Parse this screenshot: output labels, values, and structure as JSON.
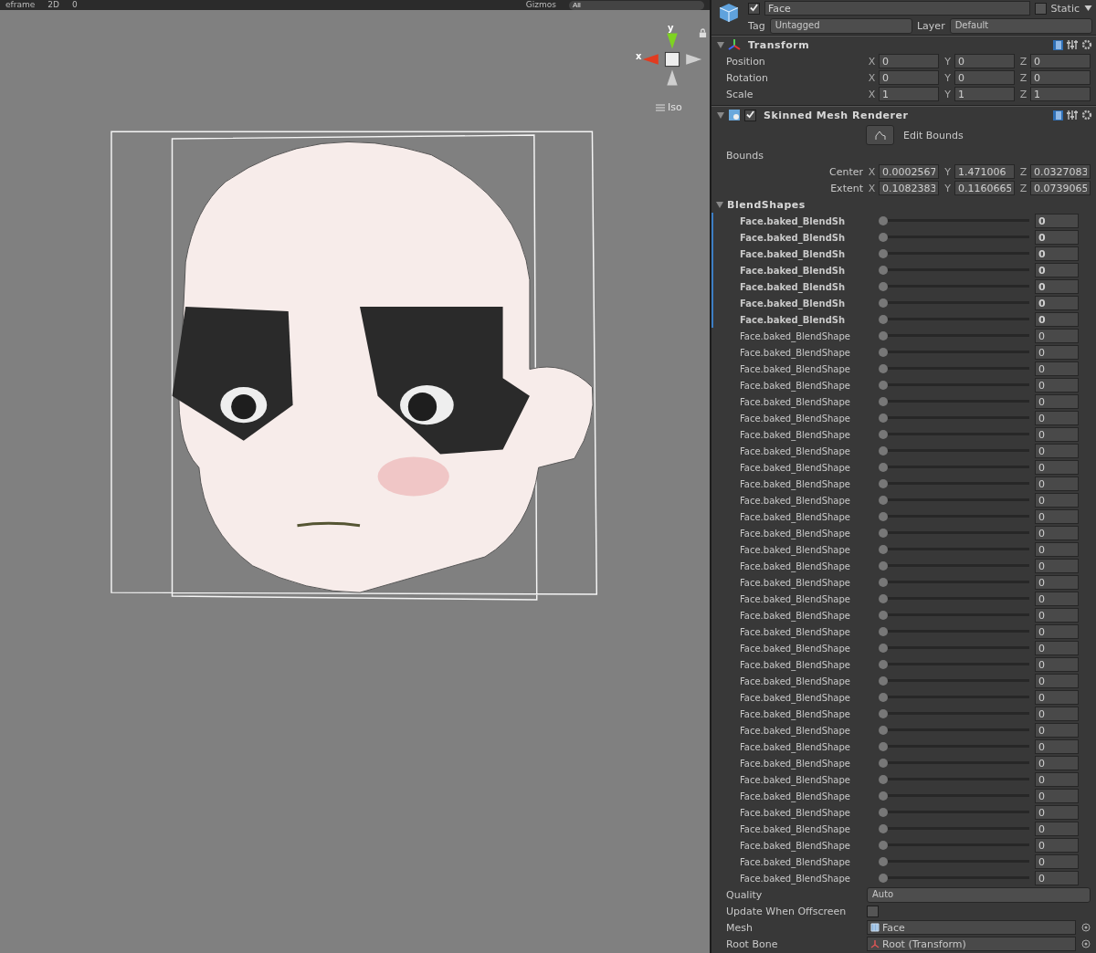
{
  "scene_toolbar": {
    "items": [
      "eframe",
      "2D",
      "0",
      "Gizmos"
    ],
    "search": {
      "placeholder": "All"
    }
  },
  "scene_view": {
    "gizmo": {
      "x_label": "x",
      "y_label": "y"
    },
    "projection": "Iso"
  },
  "inspector": {
    "object": {
      "active": true,
      "name": "Face",
      "static": false,
      "static_label": "Static",
      "tag_label": "Tag",
      "tag": "Untagged",
      "layer_label": "Layer",
      "layer": "Default"
    },
    "transform": {
      "title": "Transform",
      "expanded": true,
      "rows": [
        {
          "label": "Position",
          "fields": [
            {
              "axis": "X",
              "value": "0"
            },
            {
              "axis": "Y",
              "value": "0"
            },
            {
              "axis": "Z",
              "value": "0"
            }
          ]
        },
        {
          "label": "Rotation",
          "fields": [
            {
              "axis": "X",
              "value": "0"
            },
            {
              "axis": "Y",
              "value": "0"
            },
            {
              "axis": "Z",
              "value": "0"
            }
          ]
        },
        {
          "label": "Scale",
          "fields": [
            {
              "axis": "X",
              "value": "1"
            },
            {
              "axis": "Y",
              "value": "1"
            },
            {
              "axis": "Z",
              "value": "1"
            }
          ]
        }
      ]
    },
    "skinned_mesh_renderer": {
      "title": "Skinned Mesh Renderer",
      "enabled": true,
      "expanded": true,
      "edit_bounds": "Edit Bounds",
      "bounds_label": "Bounds",
      "bounds": [
        {
          "label": "Center",
          "fields": [
            {
              "axis": "X",
              "value": "0.0002567"
            },
            {
              "axis": "Y",
              "value": "1.471006"
            },
            {
              "axis": "Z",
              "value": "0.0327083"
            }
          ]
        },
        {
          "label": "Extent",
          "fields": [
            {
              "axis": "X",
              "value": "0.1082383"
            },
            {
              "axis": "Y",
              "value": "0.1160665"
            },
            {
              "axis": "Z",
              "value": "0.0739065"
            }
          ]
        }
      ],
      "blendshapes_title": "BlendShapes",
      "blendshapes_expanded": true,
      "blendshapes": [
        {
          "name": "Face.baked_BlendSh",
          "modified": true,
          "level": 0,
          "value": "0"
        },
        {
          "name": "Face.baked_BlendSh",
          "modified": true,
          "level": 0,
          "value": "0"
        },
        {
          "name": "Face.baked_BlendSh",
          "modified": true,
          "level": 0,
          "value": "0"
        },
        {
          "name": "Face.baked_BlendSh",
          "modified": true,
          "level": 0,
          "value": "0"
        },
        {
          "name": "Face.baked_BlendSh",
          "modified": true,
          "level": 0,
          "value": "0"
        },
        {
          "name": "Face.baked_BlendSh",
          "modified": true,
          "level": 0,
          "value": "0"
        },
        {
          "name": "Face.baked_BlendSh",
          "modified": true,
          "level": 0,
          "value": "0"
        },
        {
          "name": "Face.baked_BlendShape",
          "modified": false,
          "level": 0,
          "value": "0"
        },
        {
          "name": "Face.baked_BlendShape",
          "modified": false,
          "level": 0,
          "value": "0"
        },
        {
          "name": "Face.baked_BlendShape",
          "modified": false,
          "level": 0,
          "value": "0"
        },
        {
          "name": "Face.baked_BlendShape",
          "modified": false,
          "level": 0,
          "value": "0"
        },
        {
          "name": "Face.baked_BlendShape",
          "modified": false,
          "level": 0,
          "value": "0"
        },
        {
          "name": "Face.baked_BlendShape",
          "modified": false,
          "level": 0,
          "value": "0"
        },
        {
          "name": "Face.baked_BlendShape",
          "modified": false,
          "level": 0,
          "value": "0"
        },
        {
          "name": "Face.baked_BlendShape",
          "modified": false,
          "level": 0,
          "value": "0"
        },
        {
          "name": "Face.baked_BlendShape",
          "modified": false,
          "level": 0,
          "value": "0"
        },
        {
          "name": "Face.baked_BlendShape",
          "modified": false,
          "level": 0,
          "value": "0"
        },
        {
          "name": "Face.baked_BlendShape",
          "modified": false,
          "level": 0,
          "value": "0"
        },
        {
          "name": "Face.baked_BlendShape",
          "modified": false,
          "level": 0,
          "value": "0"
        },
        {
          "name": "Face.baked_BlendShape",
          "modified": false,
          "level": 0,
          "value": "0"
        },
        {
          "name": "Face.baked_BlendShape",
          "modified": false,
          "level": 0,
          "value": "0"
        },
        {
          "name": "Face.baked_BlendShape",
          "modified": false,
          "level": 0,
          "value": "0"
        },
        {
          "name": "Face.baked_BlendShape",
          "modified": false,
          "level": 0,
          "value": "0"
        },
        {
          "name": "Face.baked_BlendShape",
          "modified": false,
          "level": 0,
          "value": "0"
        },
        {
          "name": "Face.baked_BlendShape",
          "modified": false,
          "level": 0,
          "value": "0"
        },
        {
          "name": "Face.baked_BlendShape",
          "modified": false,
          "level": 0,
          "value": "0"
        },
        {
          "name": "Face.baked_BlendShape",
          "modified": false,
          "level": 0,
          "value": "0"
        },
        {
          "name": "Face.baked_BlendShape",
          "modified": false,
          "level": 0,
          "value": "0"
        },
        {
          "name": "Face.baked_BlendShape",
          "modified": false,
          "level": 0,
          "value": "0"
        },
        {
          "name": "Face.baked_BlendShape",
          "modified": false,
          "level": 0,
          "value": "0"
        },
        {
          "name": "Face.baked_BlendShape",
          "modified": false,
          "level": 0,
          "value": "0"
        },
        {
          "name": "Face.baked_BlendShape",
          "modified": false,
          "level": 0,
          "value": "0"
        },
        {
          "name": "Face.baked_BlendShape",
          "modified": false,
          "level": 0,
          "value": "0"
        },
        {
          "name": "Face.baked_BlendShape",
          "modified": false,
          "level": 0,
          "value": "0"
        },
        {
          "name": "Face.baked_BlendShape",
          "modified": false,
          "level": 0,
          "value": "0"
        },
        {
          "name": "Face.baked_BlendShape",
          "modified": false,
          "level": 0,
          "value": "0"
        },
        {
          "name": "Face.baked_BlendShape",
          "modified": false,
          "level": 0,
          "value": "0"
        },
        {
          "name": "Face.baked_BlendShape",
          "modified": false,
          "level": 0,
          "value": "0"
        },
        {
          "name": "Face.baked_BlendShape",
          "modified": false,
          "level": 0,
          "value": "0"
        },
        {
          "name": "Face.baked_BlendShape",
          "modified": false,
          "level": 0,
          "value": "0"
        },
        {
          "name": "Face.baked_BlendShape",
          "modified": false,
          "level": 0,
          "value": "0"
        }
      ],
      "quality_label": "Quality",
      "quality": "Auto",
      "update_offscreen_label": "Update When Offscreen",
      "update_offscreen": false,
      "mesh_label": "Mesh",
      "mesh": "Face",
      "root_bone_label": "Root Bone",
      "root_bone": "Root (Transform)"
    }
  }
}
